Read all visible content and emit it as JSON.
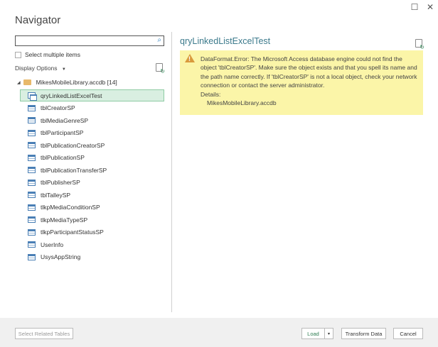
{
  "window": {
    "title": "Navigator",
    "maximize_icon": "maximize-icon",
    "close_icon": "close-icon"
  },
  "search": {
    "value": "",
    "placeholder": ""
  },
  "select_multiple": {
    "label": "Select multiple items",
    "checked": false
  },
  "display_options": {
    "label": "Display Options",
    "arrow": "▼"
  },
  "tree": {
    "root": {
      "label": "MikesMobileLibrary.accdb [14]",
      "expander": "◢"
    },
    "items": [
      {
        "label": "qryLinkedListExcelTest",
        "type": "query",
        "selected": true
      },
      {
        "label": "tblCreatorSP",
        "type": "table"
      },
      {
        "label": "tblMediaGenreSP",
        "type": "table"
      },
      {
        "label": "tblParticipantSP",
        "type": "table"
      },
      {
        "label": "tblPublicationCreatorSP",
        "type": "table"
      },
      {
        "label": "tblPublicationSP",
        "type": "table"
      },
      {
        "label": "tblPublicationTransferSP",
        "type": "table"
      },
      {
        "label": "tblPublisherSP",
        "type": "table"
      },
      {
        "label": "tblTalleySP",
        "type": "table"
      },
      {
        "label": "tlkpMediaConditionSP",
        "type": "table"
      },
      {
        "label": "tlkpMediaTypeSP",
        "type": "table"
      },
      {
        "label": "tlkpParticipantStatusSP",
        "type": "table"
      },
      {
        "label": "UserInfo",
        "type": "table"
      },
      {
        "label": "UsysAppString",
        "type": "table"
      }
    ]
  },
  "preview": {
    "title": "qryLinkedListExcelTest",
    "error": {
      "message": "DataFormat.Error: The Microsoft Access database engine could not find the object 'tblCreatorSP'. Make sure the object exists and that you spell its name and the path name correctly. If 'tblCreatorSP' is not a local object, check your network connection or contact the server administrator.",
      "details_label": "Details:",
      "details_value": "MikesMobileLibrary.accdb"
    }
  },
  "footer": {
    "select_related": "Select Related Tables",
    "load": "Load",
    "load_arrow": "▾",
    "transform": "Transform Data",
    "cancel": "Cancel"
  },
  "colors": {
    "selected_bg": "#d9efe1",
    "error_bg": "#fbf5a8",
    "title_accent": "#3c7a8c"
  }
}
